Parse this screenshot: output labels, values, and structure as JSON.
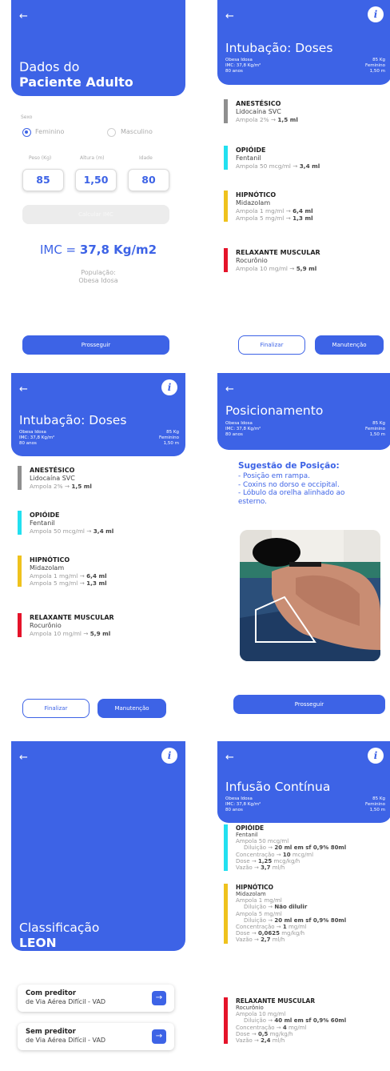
{
  "common": {
    "back_icon": "←",
    "info_icon": "i",
    "meta_left": [
      "Obesa Idosa",
      "IMC: 37,8 Kg/m²",
      "80 anos"
    ],
    "meta_right": [
      "85 Kg",
      "Feminino",
      "1,50 m"
    ]
  },
  "dados": {
    "title_line1": "Dados do",
    "title_line2": "Paciente Adulto",
    "sexo_label": "Sexo",
    "sexo_options": [
      "Feminino",
      "Masculino"
    ],
    "sexo_selected": "Feminino",
    "fields": [
      {
        "label": "Peso (Kg)",
        "value": "85"
      },
      {
        "label": "Altura (m)",
        "value": "1,50"
      },
      {
        "label": "Idade",
        "value": "80"
      }
    ],
    "calc_button": "Calcular IMC",
    "imc_prefix": "IMC = ",
    "imc_value": "37,8 Kg/m2",
    "pop_label": "População:",
    "pop_value": "Obesa Idosa",
    "proceed": "Prosseguir"
  },
  "doses": {
    "title": "Intubação: Doses",
    "drugs": [
      {
        "category": "ANESTÉSICO",
        "name": "Lidocaína SVC",
        "lines": [
          {
            "text": "Ampola 2% → ",
            "bold": "1,5 ml"
          }
        ],
        "color": "#8f8f8f"
      },
      {
        "category": "OPIÓIDE",
        "name": "Fentanil",
        "lines": [
          {
            "text": "Ampola 50 mcg/ml → ",
            "bold": "3,4 ml"
          }
        ],
        "color": "#22e0f0"
      },
      {
        "category": "HIPNÓTICO",
        "name": "Midazolam",
        "lines": [
          {
            "text": "Ampola 1 mg/ml → ",
            "bold": "6,4 ml"
          },
          {
            "text": "Ampola 5 mg/ml → ",
            "bold": "1,3 ml"
          }
        ],
        "color": "#efc21d"
      },
      {
        "category": "RELAXANTE MUSCULAR",
        "name": "Rocurônio",
        "lines": [
          {
            "text": "Ampola 10 mg/ml → ",
            "bold": "5,9 ml"
          }
        ],
        "color": "#e5132a"
      }
    ],
    "finalize": "Finalizar",
    "maintenance": "Manutenção"
  },
  "posicionamento": {
    "title": "Posicionamento",
    "suggestion_title": "Sugestão de Posição:",
    "suggestions": [
      "- Posição em rampa.",
      "- Coxins no dorso e occipital.",
      "- Lóbulo da orelha alinhado ao",
      "esterno."
    ],
    "proceed": "Prosseguir"
  },
  "leon": {
    "title_line1": "Classificação",
    "title_line2": "LEON",
    "cards": [
      {
        "line1": "Com preditor",
        "line2": "de Via Aérea Difícil - VAD"
      },
      {
        "line1": "Sem preditor",
        "line2": "de Via Aérea Difícil - VAD"
      }
    ],
    "arrow_icon": "→"
  },
  "infusao": {
    "title": "Infusão Contínua",
    "sections": [
      {
        "category": "OPIÓIDE",
        "color": "#22e0f0",
        "lines": [
          {
            "text": "Fentanil",
            "bold": "",
            "tail": "",
            "dark": true,
            "indent": false
          },
          {
            "text": "Ampola 50 mcg/ml",
            "bold": "",
            "tail": "",
            "dark": false,
            "indent": false
          },
          {
            "text": "Diluição → ",
            "bold": "20 ml em sf 0,9% 80ml",
            "tail": "",
            "dark": false,
            "indent": true
          },
          {
            "text": "Concentração → ",
            "bold": "10",
            "tail": " mcg/ml",
            "dark": false,
            "indent": false
          },
          {
            "text": "Dose → ",
            "bold": "1,25",
            "tail": " mcg/kg/h",
            "dark": false,
            "indent": false
          },
          {
            "text": "Vazão → ",
            "bold": "3,7",
            "tail": " ml/h",
            "dark": false,
            "indent": false
          }
        ]
      },
      {
        "category": "HIPNÓTICO",
        "color": "#efc21d",
        "lines": [
          {
            "text": "Midazolam",
            "bold": "",
            "tail": "",
            "dark": true,
            "indent": false
          },
          {
            "text": "Ampola 1 mg/ml",
            "bold": "",
            "tail": "",
            "dark": false,
            "indent": false
          },
          {
            "text": "Diluição → ",
            "bold": "Não dilulir",
            "tail": "",
            "dark": false,
            "indent": true
          },
          {
            "text": "Ampola 5 mg/ml",
            "bold": "",
            "tail": "",
            "dark": false,
            "indent": false
          },
          {
            "text": "Diluição → ",
            "bold": "20 ml em sf 0,9% 80ml",
            "tail": "",
            "dark": false,
            "indent": true
          },
          {
            "text": "Concentração → ",
            "bold": "1",
            "tail": " mg/ml",
            "dark": false,
            "indent": false
          },
          {
            "text": "Dose → ",
            "bold": "0,0625",
            "tail": " mg/kg/h",
            "dark": false,
            "indent": false
          },
          {
            "text": "Vazão → ",
            "bold": "2,7",
            "tail": " ml/h",
            "dark": false,
            "indent": false
          }
        ]
      },
      {
        "category": "RELAXANTE MUSCULAR",
        "color": "#e5132a",
        "lines": [
          {
            "text": "Rocurônio",
            "bold": "",
            "tail": "",
            "dark": true,
            "indent": false
          },
          {
            "text": "Ampola 10 mg/ml",
            "bold": "",
            "tail": "",
            "dark": false,
            "indent": false
          },
          {
            "text": "Diluição → ",
            "bold": "40 ml em sf 0,9% 60ml",
            "tail": "",
            "dark": false,
            "indent": true
          },
          {
            "text": "Concentração → ",
            "bold": "4",
            "tail": " mg/ml",
            "dark": false,
            "indent": false
          },
          {
            "text": "Dose → ",
            "bold": "0,5",
            "tail": " mg/kg/h",
            "dark": false,
            "indent": false
          },
          {
            "text": "Vazão → ",
            "bold": "2,4",
            "tail": " ml/h",
            "dark": false,
            "indent": false
          }
        ]
      }
    ]
  },
  "colors": {
    "primary": "#3d63e6",
    "disabled": "#ececec"
  }
}
